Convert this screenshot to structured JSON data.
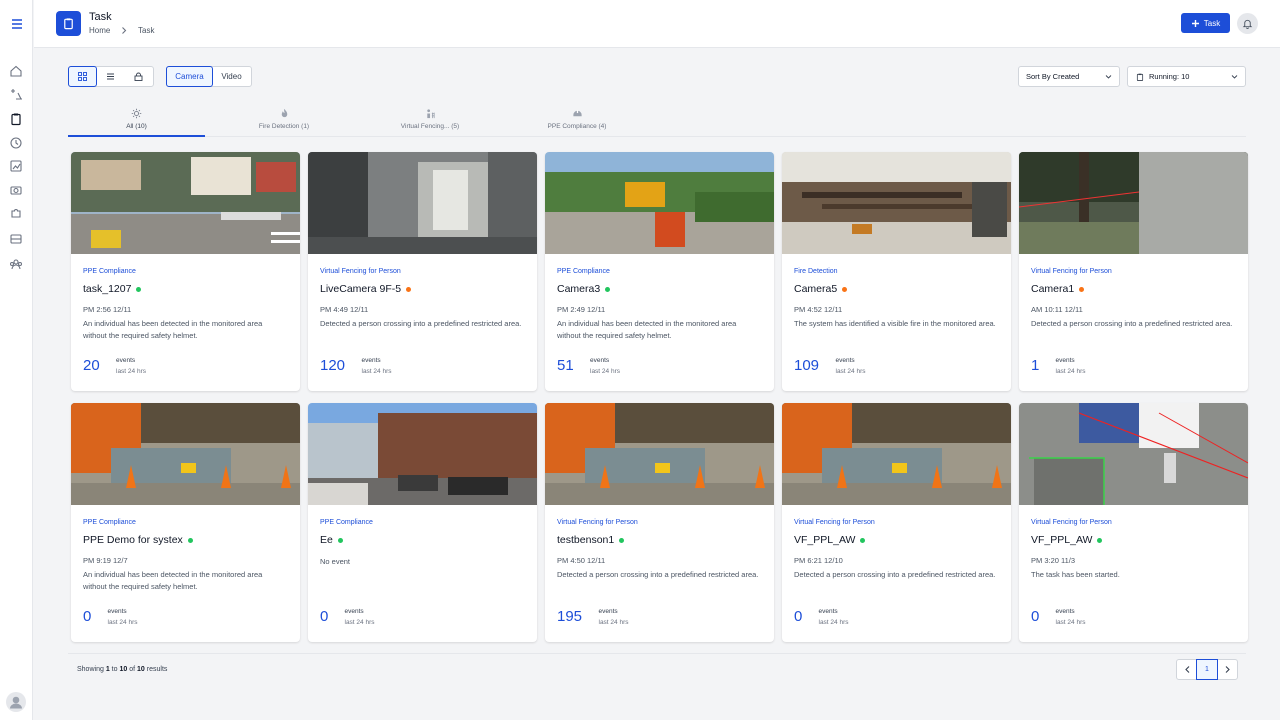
{
  "header": {
    "title": "Task",
    "breadcrumb": [
      "Home",
      "Task"
    ],
    "add_task_label": "Task"
  },
  "toolbar": {
    "source_tabs": [
      "Camera",
      "Video"
    ],
    "active_source": "Camera",
    "sort_label": "Sort By Created",
    "status_label": "Running: 10"
  },
  "tabs": [
    {
      "label": "All (10)",
      "icon": "sun-icon",
      "active": true
    },
    {
      "label": "Fire Detection (1)",
      "icon": "fire-icon",
      "active": false
    },
    {
      "label": "Virtual Fencing... (5)",
      "icon": "person-fence-icon",
      "active": false
    },
    {
      "label": "PPE Compliance (4)",
      "icon": "helmet-icon",
      "active": false
    }
  ],
  "cards": [
    {
      "category": "PPE Compliance",
      "name": "task_1207",
      "status": "green",
      "time": "PM 2:56 12/11",
      "description": "An individual has been detected in the monitored area without the required safety helmet.",
      "count": "20",
      "events_label": "events",
      "period": "last 24 hrs",
      "thumb": "street"
    },
    {
      "category": "Virtual Fencing for Person",
      "name": "LiveCamera 9F-5",
      "status": "orange",
      "time": "PM 4:49 12/11",
      "description": "Detected a person crossing into a predefined restricted area.",
      "count": "120",
      "events_label": "events",
      "period": "last 24 hrs",
      "thumb": "office"
    },
    {
      "category": "PPE Compliance",
      "name": "Camera3",
      "status": "green",
      "time": "PM 2:49 12/11",
      "description": "An individual has been detected in the monitored area without the required safety helmet.",
      "count": "51",
      "events_label": "events",
      "period": "last 24 hrs",
      "thumb": "worksite"
    },
    {
      "category": "Fire Detection",
      "name": "Camera5",
      "status": "orange",
      "time": "PM 4:52 12/11",
      "description": "The system has identified a visible fire in the monitored area.",
      "count": "109",
      "events_label": "events",
      "period": "last 24 hrs",
      "thumb": "welding"
    },
    {
      "category": "Virtual Fencing for Person",
      "name": "Camera1",
      "status": "orange",
      "time": "AM 10:11 12/11",
      "description": "Detected a person crossing into a predefined restricted area.",
      "count": "1",
      "events_label": "events",
      "period": "last 24 hrs",
      "thumb": "park"
    },
    {
      "category": "PPE Compliance",
      "name": "PPE Demo for systex",
      "status": "green",
      "time": "PM 9:19 12/7",
      "description": "An individual has been detected in the monitored area without the required safety helmet.",
      "count": "0",
      "events_label": "events",
      "period": "last 24 hrs",
      "thumb": "excavator"
    },
    {
      "category": "PPE Compliance",
      "name": "Ee",
      "status": "green",
      "time": "",
      "description": "No event",
      "count": "0",
      "events_label": "events",
      "period": "last 24 hrs",
      "thumb": "city"
    },
    {
      "category": "Virtual Fencing for Person",
      "name": "testbenson1",
      "status": "green",
      "time": "PM 4:50 12/11",
      "description": "Detected a person crossing into a predefined restricted area.",
      "count": "195",
      "events_label": "events",
      "period": "last 24 hrs",
      "thumb": "excavator"
    },
    {
      "category": "Virtual Fencing for Person",
      "name": "VF_PPL_AW",
      "status": "green",
      "time": "PM 6:21 12/10",
      "description": "Detected a person crossing into a predefined restricted area.",
      "count": "0",
      "events_label": "events",
      "period": "last 24 hrs",
      "thumb": "excavator"
    },
    {
      "category": "Virtual Fencing for Person",
      "name": "VF_PPL_AW",
      "status": "green",
      "time": "PM 3:20 11/3",
      "description": "The task has been started.",
      "count": "0",
      "events_label": "events",
      "period": "last 24 hrs",
      "thumb": "truck"
    }
  ],
  "footer": {
    "showing_prefix": "Showing",
    "from": "1",
    "to_word": "to",
    "to": "10",
    "of_word": "of",
    "total": "10",
    "results_word": "results",
    "current_page": "1"
  },
  "colors": {
    "accent": "#1d4ed8",
    "status_green": "#22c55e",
    "status_orange": "#f97316"
  }
}
